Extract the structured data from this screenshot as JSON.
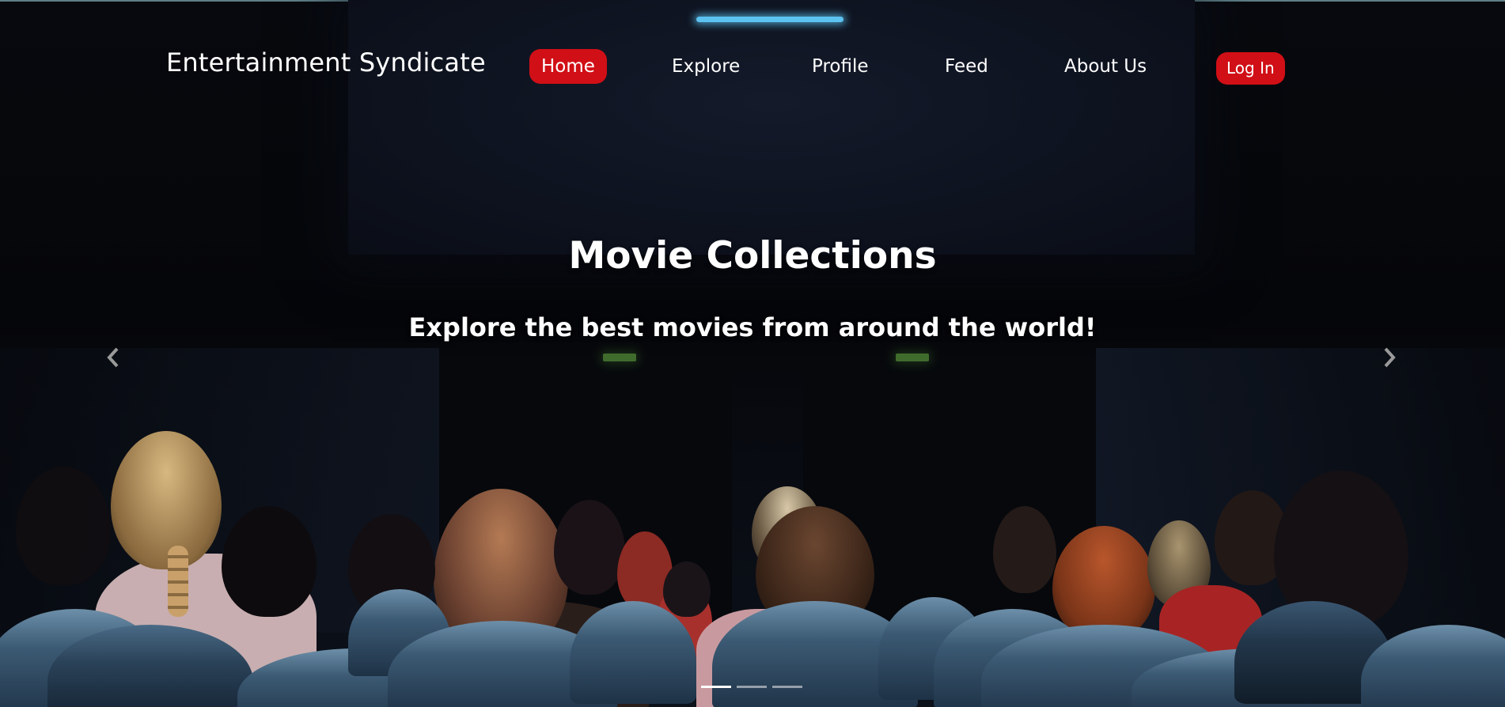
{
  "brand": {
    "name": "Entertainment Syndicate"
  },
  "nav": {
    "items": [
      {
        "label": "Home",
        "active": true
      },
      {
        "label": "Explore",
        "active": false
      },
      {
        "label": "Profile",
        "active": false
      },
      {
        "label": "Feed",
        "active": false
      },
      {
        "label": "About Us",
        "active": false
      }
    ],
    "login_label": "Log In"
  },
  "carousel": {
    "title": "Movie Collections",
    "subtitle": "Explore the best movies from around the world!",
    "prev_icon": "chevron-left-icon",
    "next_icon": "chevron-right-icon",
    "slide_count": 3,
    "active_slide": 1
  },
  "colors": {
    "accent": "#d10f16",
    "screen_glow": "#5cc2f0",
    "seat": "#3c5a74"
  }
}
